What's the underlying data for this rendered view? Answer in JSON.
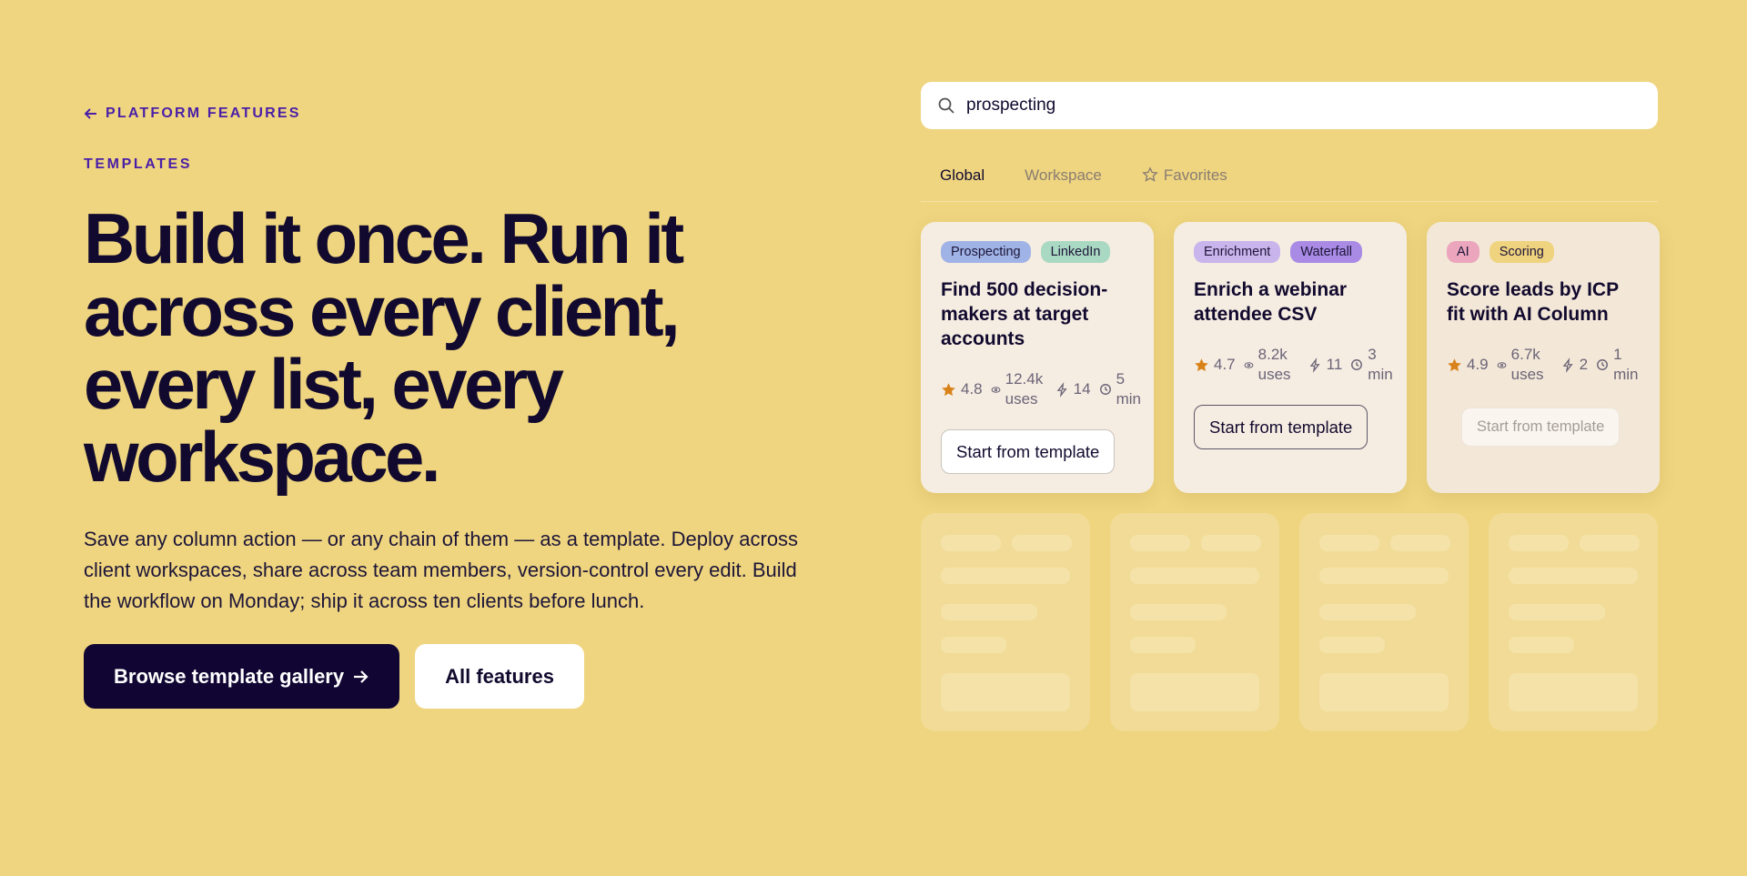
{
  "nav": {
    "back_label": "PLATFORM FEATURES"
  },
  "hero": {
    "eyebrow": "TEMPLATES",
    "headline": "Build it once. Run it across every client, every list, every workspace.",
    "subcopy": "Save any column action — or any chain of them — as a template. Deploy across client workspaces, share across team members, version-control every edit. Build the workflow on Monday; ship it across ten clients before lunch.",
    "primary_cta": "Browse template gallery",
    "secondary_cta": "All features"
  },
  "search": {
    "value": "prospecting",
    "icon": "search-icon"
  },
  "tabs": [
    {
      "label": "Global",
      "active": true
    },
    {
      "label": "Workspace",
      "active": false
    },
    {
      "label": "Favorites",
      "active": false,
      "icon": "star-outline-icon"
    }
  ],
  "cards": [
    {
      "tags": [
        {
          "label": "Prospecting",
          "color": "#9FB3E6"
        },
        {
          "label": "LinkedIn",
          "color": "#A9D9C2"
        }
      ],
      "title": "Find 500 decision-makers at target accounts",
      "rating": "4.8",
      "uses": "12.4k uses",
      "steps": "14",
      "time": "5 min",
      "button": "Start from template"
    },
    {
      "tags": [
        {
          "label": "Enrichment",
          "color": "#C9B4EC"
        },
        {
          "label": "Waterfall",
          "color": "#A98BE6"
        }
      ],
      "title": "Enrich a webinar attendee CSV",
      "rating": "4.7",
      "uses": "8.2k uses",
      "steps": "11",
      "time": "3 min",
      "button": "Start from template"
    },
    {
      "tags": [
        {
          "label": "AI",
          "color": "#EBA6BE"
        },
        {
          "label": "Scoring",
          "color": "#F0D37F"
        }
      ],
      "title": "Score leads by ICP fit with AI Column",
      "rating": "4.9",
      "uses": "6.7k uses",
      "steps": "2",
      "time": "1 min",
      "button": "Start from template"
    }
  ],
  "colors": {
    "background": "#EFD57F",
    "accent": "#4A1FA8",
    "ink": "#120A2E",
    "star": "#D9821A"
  }
}
